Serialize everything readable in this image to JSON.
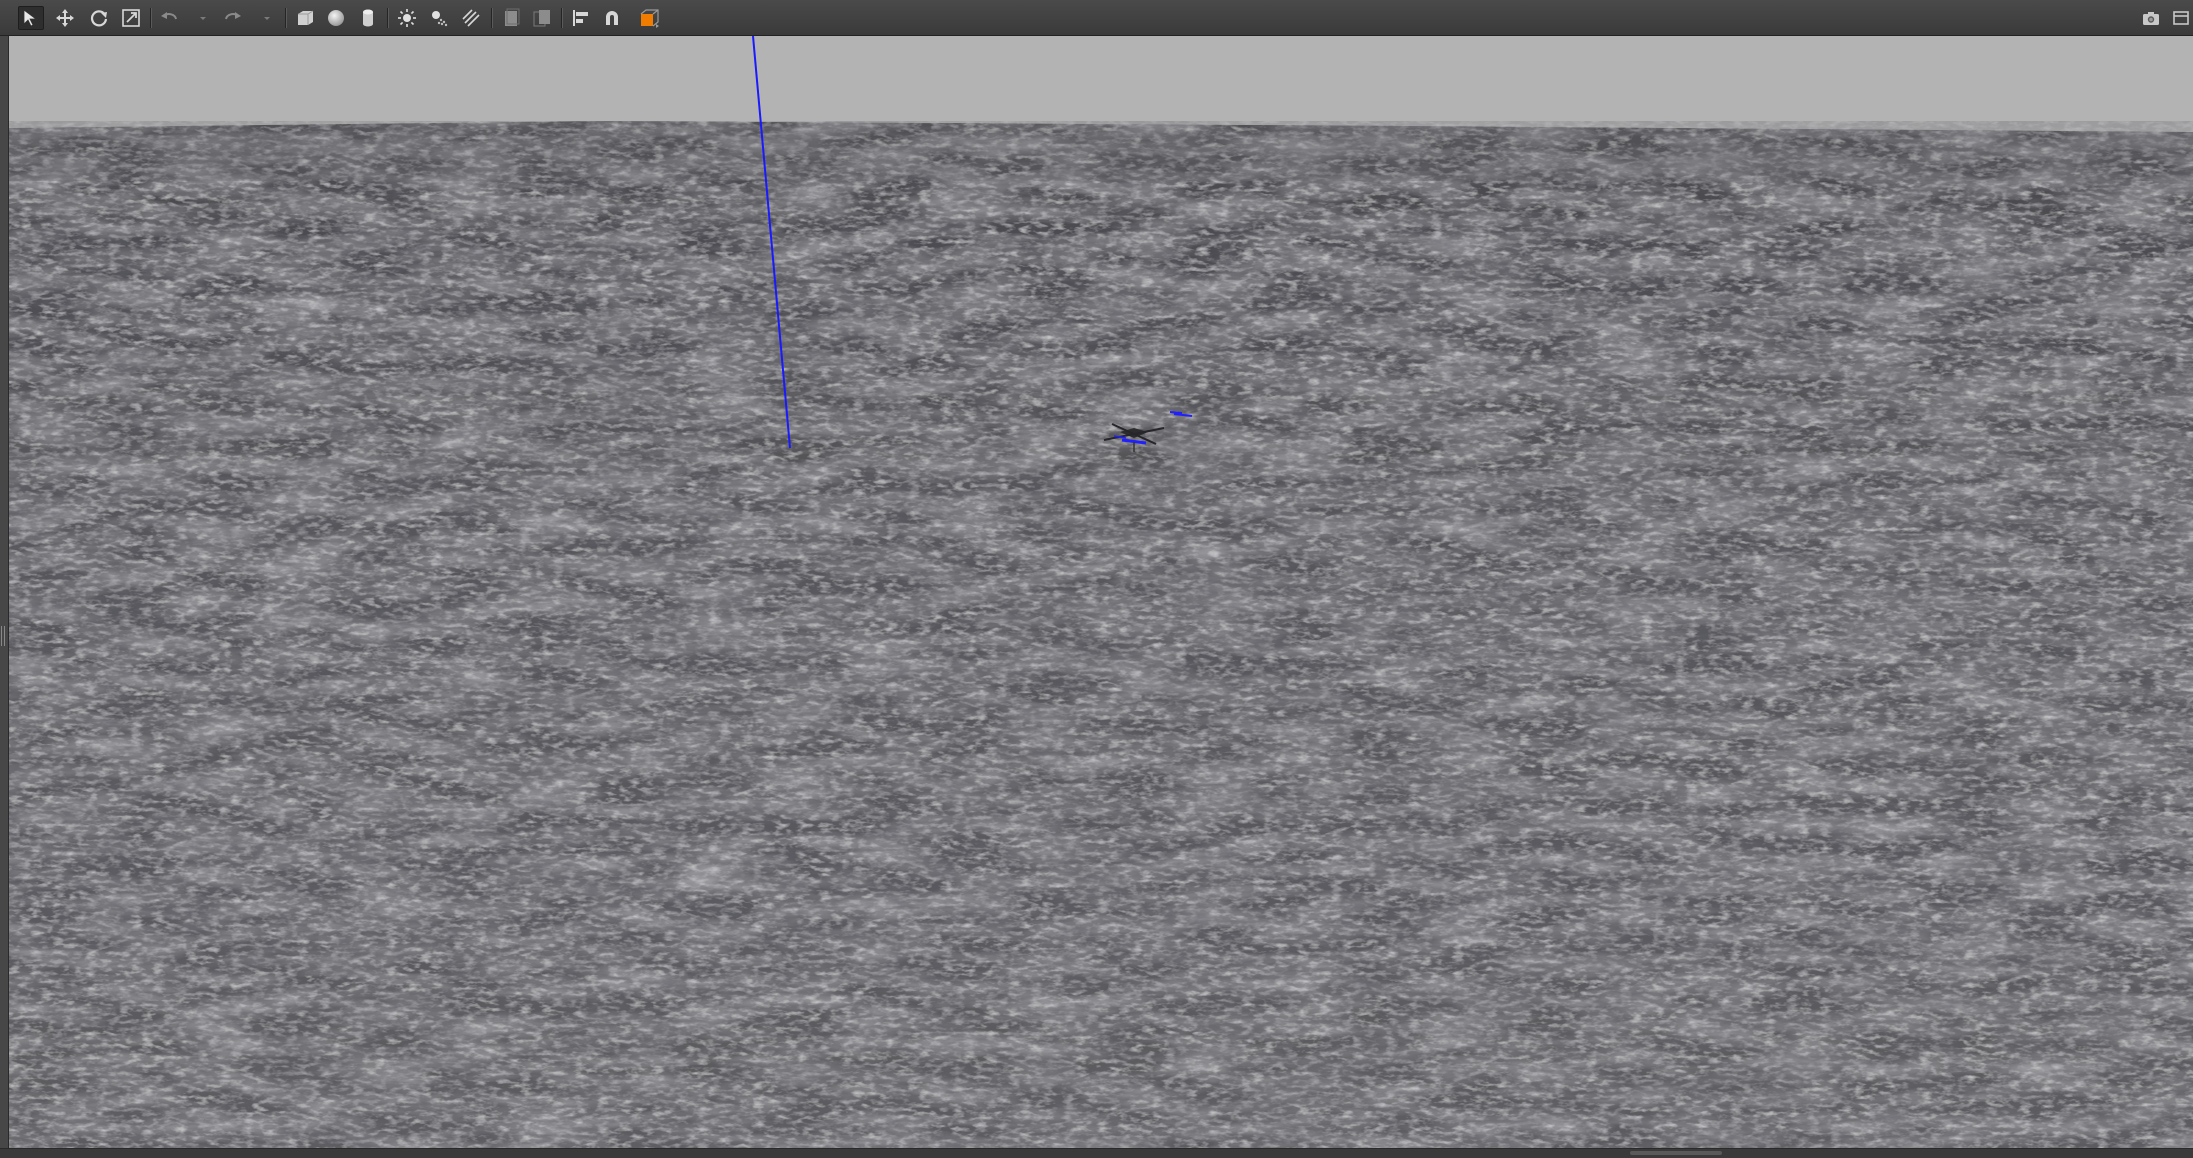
{
  "toolbar": {
    "tools": [
      {
        "name": "select-mode-icon",
        "active": true
      },
      {
        "name": "translate-mode-icon"
      },
      {
        "name": "rotate-mode-icon"
      },
      {
        "name": "scale-mode-icon"
      },
      {
        "name": "undo-icon"
      },
      {
        "name": "undo-history-dropdown-icon"
      },
      {
        "name": "redo-icon"
      },
      {
        "name": "redo-history-dropdown-icon"
      },
      {
        "name": "box-shape-icon"
      },
      {
        "name": "sphere-shape-icon"
      },
      {
        "name": "cylinder-shape-icon"
      },
      {
        "name": "point-light-icon"
      },
      {
        "name": "spot-light-icon"
      },
      {
        "name": "directional-light-icon"
      },
      {
        "name": "copy-icon"
      },
      {
        "name": "paste-icon"
      },
      {
        "name": "align-icon"
      },
      {
        "name": "snap-icon"
      },
      {
        "name": "change-view-angle-icon"
      },
      {
        "name": "screenshot-icon"
      }
    ]
  },
  "scene": {
    "sky_color": "#b3b3b3",
    "ground_color": "#5d5d62",
    "ground_dark_color": "#3f3f44",
    "axis_color": "#1a1aff",
    "model_name": "quadcopter-model"
  }
}
